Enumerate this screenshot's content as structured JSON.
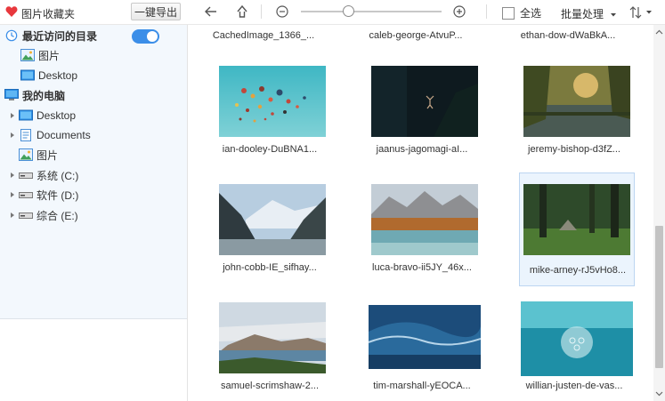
{
  "app": {
    "title": "图片收藏夹"
  },
  "toolbar": {
    "export_label": "一键导出",
    "back_icon": "arrow-left-icon",
    "up_icon": "arrow-up-icon",
    "zoom_out_icon": "minus-circle-icon",
    "zoom_in_icon": "plus-circle-icon",
    "zoom_level": 0.32,
    "select_all_label": "全选",
    "batch_label": "批量处理",
    "sort_icon": "sort-icon"
  },
  "sidebar": {
    "recent": {
      "label": "最近访问的目录",
      "toggle_on": true
    },
    "recent_items": [
      {
        "label": "图片",
        "icon": "pictures-folder-icon"
      },
      {
        "label": "Desktop",
        "icon": "desktop-folder-icon"
      }
    ],
    "computer": {
      "label": "我的电脑"
    },
    "computer_items": [
      {
        "label": "Desktop",
        "icon": "desktop-folder-icon",
        "expandable": true
      },
      {
        "label": "Documents",
        "icon": "documents-folder-icon",
        "expandable": true
      },
      {
        "label": "图片",
        "icon": "pictures-folder-icon",
        "expandable": false
      },
      {
        "label": "系统 (C:)",
        "icon": "drive-icon",
        "expandable": true
      },
      {
        "label": "软件 (D:)",
        "icon": "drive-icon",
        "expandable": true
      },
      {
        "label": "综合 (E:)",
        "icon": "drive-icon",
        "expandable": true
      }
    ]
  },
  "gallery": {
    "partial_row": [
      "CachedImage_1366_...",
      "caleb-george-AtvuP...",
      "ethan-dow-dWaBkA..."
    ],
    "items": [
      {
        "name": "ian-dooley-DuBNA1...",
        "scene": "hot-air-balloons-sky",
        "selected": false
      },
      {
        "name": "jaanus-jagomagi-aI...",
        "scene": "swimmer-dark-water",
        "selected": false
      },
      {
        "name": "jeremy-bishop-d3fZ...",
        "scene": "forest-lake-sunset",
        "selected": false
      },
      {
        "name": "john-cobb-IE_sifhay...",
        "scene": "mountain-fjord",
        "selected": false
      },
      {
        "name": "luca-bravo-ii5JY_46x...",
        "scene": "alpine-lake-autumn",
        "selected": false
      },
      {
        "name": "mike-arney-rJ5vHo8...",
        "scene": "green-forest-deer",
        "selected": true
      },
      {
        "name": "samuel-scrimshaw-2...",
        "scene": "mountain-lake-clouds",
        "selected": false
      },
      {
        "name": "tim-marshall-yEOCA...",
        "scene": "ocean-wave",
        "selected": false
      },
      {
        "name": "willian-justen-de-vas...",
        "scene": "jellyfish-underwater",
        "selected": false
      }
    ]
  },
  "colors": {
    "accent": "#3b8ee8",
    "heart": "#e8383d",
    "selection_bg": "#ebf4fd",
    "sidebar_bg": "#f3f8fd"
  }
}
